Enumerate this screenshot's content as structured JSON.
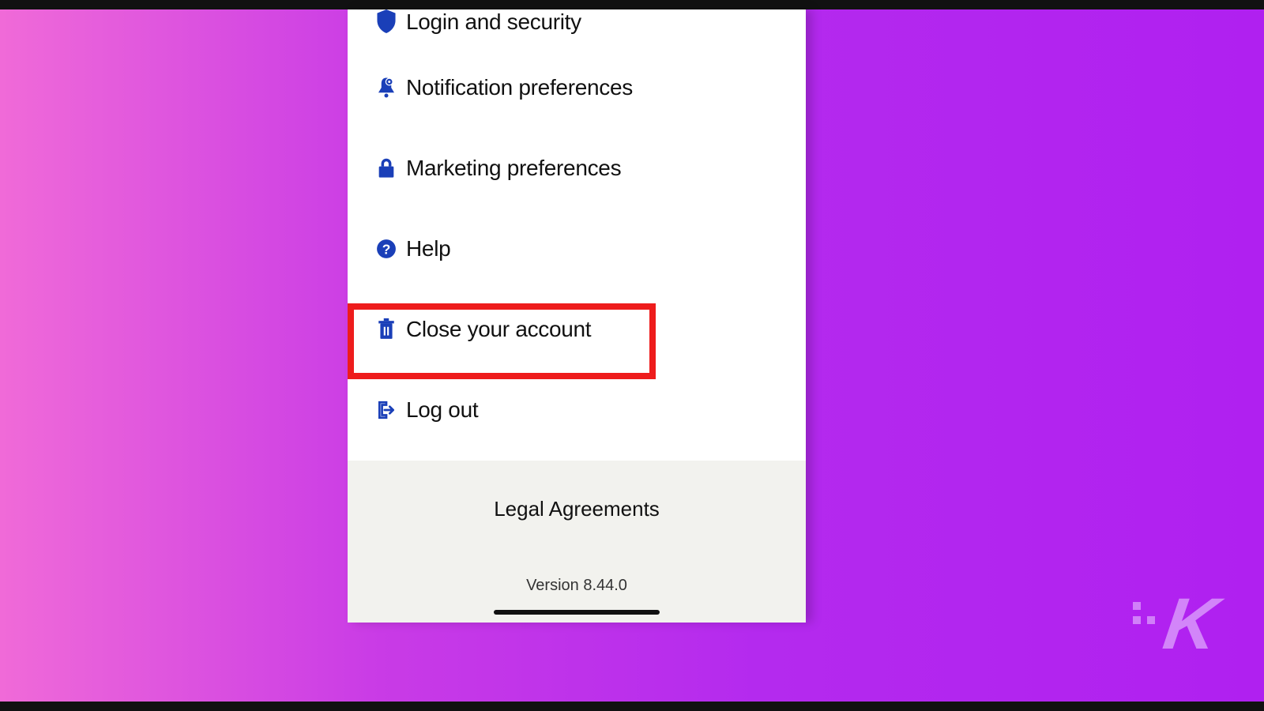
{
  "menu": {
    "items": [
      {
        "label": "Login and security",
        "icon": "shield-icon"
      },
      {
        "label": "Notification preferences",
        "icon": "bell-gear-icon"
      },
      {
        "label": "Marketing preferences",
        "icon": "lock-icon"
      },
      {
        "label": "Help",
        "icon": "help-circle-icon"
      },
      {
        "label": "Close your account",
        "icon": "trash-icon",
        "highlighted": true
      },
      {
        "label": "Log out",
        "icon": "logout-icon"
      }
    ]
  },
  "footer": {
    "legal_label": "Legal Agreements",
    "version_label": "Version 8.44.0"
  },
  "watermark": {
    "letter": "K"
  },
  "colors": {
    "icon": "#1a3fb8",
    "highlight": "#ee1c1c"
  }
}
